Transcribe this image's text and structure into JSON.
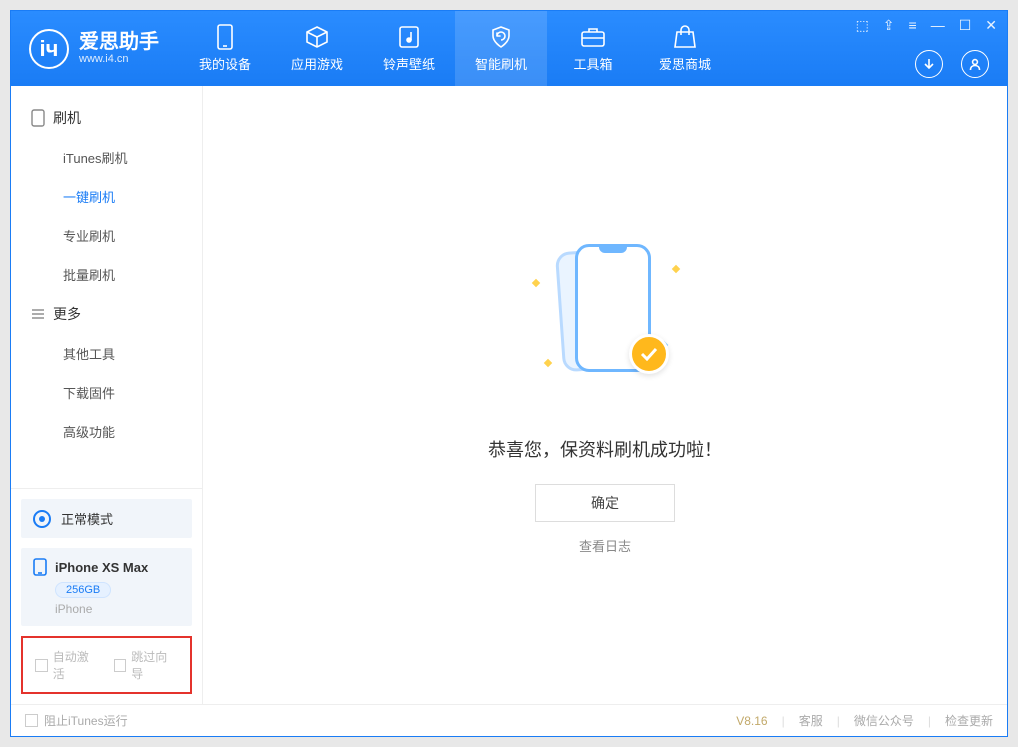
{
  "app": {
    "title": "爱思助手",
    "url": "www.i4.cn"
  },
  "tabs": [
    {
      "label": "我的设备"
    },
    {
      "label": "应用游戏"
    },
    {
      "label": "铃声壁纸"
    },
    {
      "label": "智能刷机"
    },
    {
      "label": "工具箱"
    },
    {
      "label": "爱思商城"
    }
  ],
  "sidebar": {
    "section1": {
      "title": "刷机"
    },
    "items1": [
      {
        "label": "iTunes刷机"
      },
      {
        "label": "一键刷机"
      },
      {
        "label": "专业刷机"
      },
      {
        "label": "批量刷机"
      }
    ],
    "section2": {
      "title": "更多"
    },
    "items2": [
      {
        "label": "其他工具"
      },
      {
        "label": "下载固件"
      },
      {
        "label": "高级功能"
      }
    ],
    "mode": "正常模式",
    "device": {
      "name": "iPhone XS Max",
      "capacity": "256GB",
      "type": "iPhone"
    },
    "options": {
      "auto_activate": "自动激活",
      "skip_guide": "跳过向导"
    }
  },
  "main": {
    "success_message": "恭喜您，保资料刷机成功啦！",
    "ok_button": "确定",
    "log_link": "查看日志"
  },
  "statusbar": {
    "block_itunes": "阻止iTunes运行",
    "version": "V8.16",
    "links": [
      "客服",
      "微信公众号",
      "检查更新"
    ]
  }
}
